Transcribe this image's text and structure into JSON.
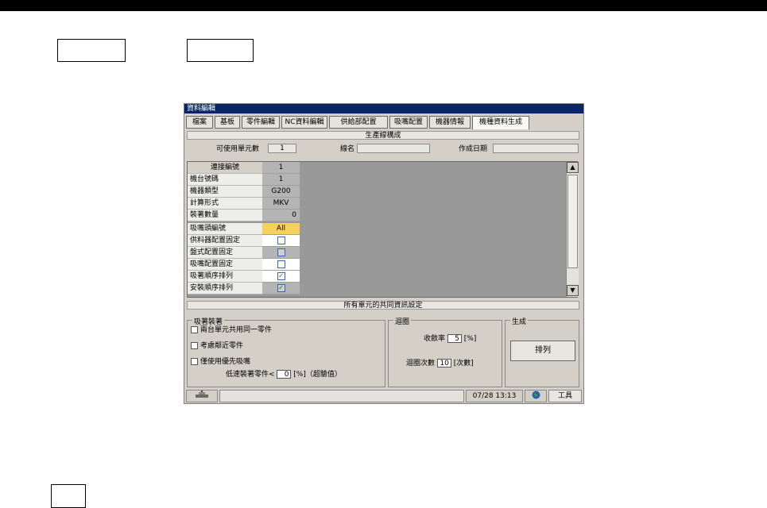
{
  "window_title": "資料編輯",
  "tabs": [
    "檔案",
    "基板",
    "零件編輯",
    "NC資料編輯",
    "供給部配置",
    "吸嘴配置",
    "機器情報",
    "機種資料生成"
  ],
  "section_title": "生產線構成",
  "info": {
    "units_label": "可使用單元數",
    "units_value": "1",
    "line_name_label": "線名",
    "line_name_value": "",
    "created_label": "作成日期",
    "created_value": ""
  },
  "grid": {
    "header": {
      "label": "連接編號",
      "value": "1"
    },
    "rows": [
      {
        "label": "機台號碼",
        "value": "1"
      },
      {
        "label": "機器類型",
        "value": "G200"
      },
      {
        "label": "計算形式",
        "value": "MKV"
      },
      {
        "label": "裝著數量",
        "value": "0"
      },
      {
        "label": "吸嘴頭編號",
        "value": "All"
      },
      {
        "label": "供料器配置固定",
        "value": ""
      },
      {
        "label": "盤式配置固定",
        "value": ""
      },
      {
        "label": "吸嘴配置固定",
        "value": ""
      },
      {
        "label": "吸著順序排列",
        "value": "✓"
      },
      {
        "label": "安裝順序排列",
        "value": "✓"
      }
    ]
  },
  "scroll": {
    "up": "▲",
    "down": "▼"
  },
  "common_bar": "所有單元的共同資訊設定",
  "group_adsorb": {
    "title": "吸著裝著",
    "opt1": "兩台單元共用同一零件",
    "opt2": "考慮鄰近零件",
    "opt3": "僅使用優先吸嘴",
    "low_speed_prefix": "低速裝著零件<",
    "low_speed_value": "0",
    "low_speed_suffix": "[%]（超驗值）"
  },
  "group_loop": {
    "title": "迴圈",
    "rate_label": "收斂率",
    "rate_value": "5",
    "rate_unit": "[%]",
    "count_label": "迴圈次數",
    "count_value": "10",
    "count_unit": "[次數]"
  },
  "group_generate": {
    "title": "生成",
    "arrange_button": "排列"
  },
  "status": {
    "time": "07/28  13:13",
    "tools_button": "工具"
  }
}
